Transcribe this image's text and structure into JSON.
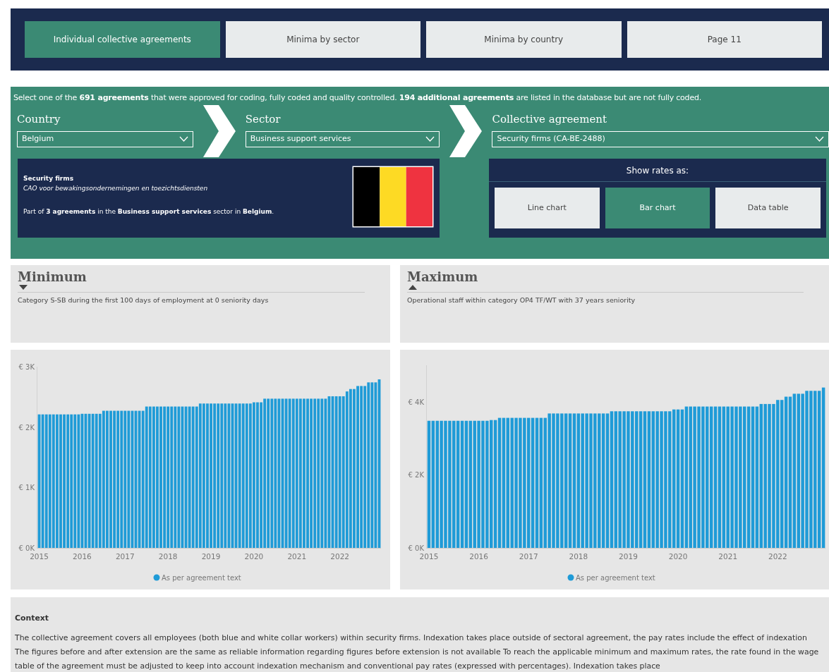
{
  "tabs": [
    {
      "label": "Individual collective agreements",
      "selected": true
    },
    {
      "label": "Minima by sector",
      "selected": false
    },
    {
      "label": "Minima by country",
      "selected": false
    },
    {
      "label": "Page 11",
      "selected": false
    }
  ],
  "filters": {
    "intro": "Select one of the **691 agreements** that were approved for coding, fully coded and quality controlled. **194 additional agreements** are listed in the database but are not fully coded.",
    "dropdowns": [
      {
        "label": "Country",
        "value": "Belgium"
      },
      {
        "label": "Sector",
        "value": "Business support services"
      },
      {
        "label": "Collective agreement",
        "value": "Security firms (CA-BE-2488)"
      }
    ]
  },
  "agreement_info": {
    "title": "Security firms",
    "subtitle": "CAO voor bewakingsondernemingen en toezichtsdiensten",
    "note": "Part of **3 agreements** in the **Business support services** sector in **Belgium**."
  },
  "rate_view": {
    "label": "Show rates as:",
    "options": [
      {
        "label": "Line chart",
        "selected": false
      },
      {
        "label": "Bar chart",
        "selected": true
      },
      {
        "label": "Data table",
        "selected": false
      }
    ]
  },
  "panels": [
    {
      "title": "Minimum",
      "kind": "minimum",
      "description": "Category S-SB during the first 100 days of employment at 0 seniority days",
      "chart_data": {
        "type": "bar",
        "x": [
          2015,
          2015.083,
          2015.167,
          2015.25,
          2015.333,
          2015.417,
          2015.5,
          2015.583,
          2015.667,
          2015.75,
          2015.833,
          2015.917,
          2016,
          2016.083,
          2016.167,
          2016.25,
          2016.333,
          2016.417,
          2016.5,
          2016.583,
          2016.667,
          2016.75,
          2016.833,
          2016.917,
          2017,
          2017.083,
          2017.167,
          2017.25,
          2017.333,
          2017.417,
          2017.5,
          2017.583,
          2017.667,
          2017.75,
          2017.833,
          2017.917,
          2018,
          2018.083,
          2018.167,
          2018.25,
          2018.333,
          2018.417,
          2018.5,
          2018.583,
          2018.667,
          2018.75,
          2018.833,
          2018.917,
          2019,
          2019.083,
          2019.167,
          2019.25,
          2019.333,
          2019.417,
          2019.5,
          2019.583,
          2019.667,
          2019.75,
          2019.833,
          2019.917,
          2020,
          2020.083,
          2020.167,
          2020.25,
          2020.333,
          2020.417,
          2020.5,
          2020.583,
          2020.667,
          2020.75,
          2020.833,
          2020.917,
          2021,
          2021.083,
          2021.167,
          2021.25,
          2021.333,
          2021.417,
          2021.5,
          2021.583,
          2021.667,
          2021.75,
          2021.833,
          2021.917,
          2022,
          2022.083,
          2022.167,
          2022.25,
          2022.333,
          2022.417,
          2022.5,
          2022.583,
          2022.667,
          2022.75,
          2022.833,
          2022.917
        ],
        "series": [
          {
            "name": "As per agreement text",
            "color": "#1f9bd7",
            "values": [
              2210,
              2210,
              2210,
              2210,
              2210,
              2210,
              2210,
              2210,
              2210,
              2210,
              2210,
              2210,
              2220,
              2220,
              2220,
              2220,
              2220,
              2220,
              2270,
              2270,
              2270,
              2270,
              2270,
              2270,
              2270,
              2270,
              2270,
              2270,
              2270,
              2270,
              2340,
              2340,
              2340,
              2340,
              2340,
              2340,
              2340,
              2340,
              2340,
              2340,
              2340,
              2340,
              2340,
              2340,
              2340,
              2390,
              2390,
              2390,
              2390,
              2390,
              2390,
              2390,
              2390,
              2390,
              2390,
              2390,
              2390,
              2390,
              2390,
              2390,
              2410,
              2410,
              2410,
              2470,
              2470,
              2470,
              2470,
              2470,
              2470,
              2470,
              2470,
              2470,
              2470,
              2470,
              2470,
              2470,
              2470,
              2470,
              2470,
              2470,
              2470,
              2510,
              2510,
              2510,
              2510,
              2510,
              2590,
              2630,
              2630,
              2680,
              2680,
              2680,
              2740,
              2740,
              2740,
              2790
            ]
          }
        ],
        "xlim": [
          2014.958,
          2022.958
        ],
        "ylim": [
          0,
          3000
        ],
        "yticks": [
          {
            "value": 0,
            "label": "€ 0K"
          },
          {
            "value": 1000,
            "label": "€ 1K"
          },
          {
            "value": 2000,
            "label": "€ 2K"
          },
          {
            "value": 3000,
            "label": "€ 3K"
          }
        ],
        "xticks": [
          2015,
          2016,
          2017,
          2018,
          2019,
          2020,
          2021,
          2022
        ]
      }
    },
    {
      "title": "Maximum",
      "kind": "maximum",
      "description": "Operational staff within category OP4 TF/WT with 37 years seniority",
      "chart_data": {
        "type": "bar",
        "x": [
          2015,
          2015.083,
          2015.167,
          2015.25,
          2015.333,
          2015.417,
          2015.5,
          2015.583,
          2015.667,
          2015.75,
          2015.833,
          2015.917,
          2016,
          2016.083,
          2016.167,
          2016.25,
          2016.333,
          2016.417,
          2016.5,
          2016.583,
          2016.667,
          2016.75,
          2016.833,
          2016.917,
          2017,
          2017.083,
          2017.167,
          2017.25,
          2017.333,
          2017.417,
          2017.5,
          2017.583,
          2017.667,
          2017.75,
          2017.833,
          2017.917,
          2018,
          2018.083,
          2018.167,
          2018.25,
          2018.333,
          2018.417,
          2018.5,
          2018.583,
          2018.667,
          2018.75,
          2018.833,
          2018.917,
          2019,
          2019.083,
          2019.167,
          2019.25,
          2019.333,
          2019.417,
          2019.5,
          2019.583,
          2019.667,
          2019.75,
          2019.833,
          2019.917,
          2020,
          2020.083,
          2020.167,
          2020.25,
          2020.333,
          2020.417,
          2020.5,
          2020.583,
          2020.667,
          2020.75,
          2020.833,
          2020.917,
          2021,
          2021.083,
          2021.167,
          2021.25,
          2021.333,
          2021.417,
          2021.5,
          2021.583,
          2021.667,
          2021.75,
          2021.833,
          2021.917,
          2022,
          2022.083,
          2022.167,
          2022.25,
          2022.333,
          2022.417,
          2022.5,
          2022.583,
          2022.667,
          2022.75,
          2022.833,
          2022.917
        ],
        "series": [
          {
            "name": "As per agreement text",
            "color": "#1f9bd7",
            "values": [
              3480,
              3480,
              3480,
              3480,
              3480,
              3480,
              3480,
              3480,
              3480,
              3480,
              3480,
              3480,
              3480,
              3480,
              3480,
              3500,
              3500,
              3560,
              3560,
              3560,
              3560,
              3560,
              3560,
              3560,
              3560,
              3560,
              3560,
              3560,
              3560,
              3680,
              3680,
              3680,
              3680,
              3680,
              3680,
              3680,
              3680,
              3680,
              3680,
              3680,
              3680,
              3680,
              3680,
              3680,
              3740,
              3740,
              3740,
              3740,
              3740,
              3740,
              3740,
              3740,
              3740,
              3740,
              3740,
              3740,
              3740,
              3740,
              3740,
              3790,
              3790,
              3790,
              3870,
              3870,
              3870,
              3870,
              3870,
              3870,
              3870,
              3870,
              3870,
              3870,
              3870,
              3870,
              3870,
              3870,
              3870,
              3870,
              3870,
              3870,
              3940,
              3940,
              3940,
              3940,
              4050,
              4050,
              4140,
              4140,
              4220,
              4220,
              4220,
              4300,
              4300,
              4300,
              4300,
              4390
            ]
          }
        ],
        "xlim": [
          2014.958,
          2022.958
        ],
        "ylim": [
          0,
          5000
        ],
        "yticks": [
          {
            "value": 0,
            "label": "€ 0K"
          },
          {
            "value": 2000,
            "label": "€ 2K"
          },
          {
            "value": 4000,
            "label": "€ 4K"
          }
        ],
        "xticks": [
          2015,
          2016,
          2017,
          2018,
          2019,
          2020,
          2021,
          2022
        ]
      }
    }
  ],
  "context": {
    "title": "Context",
    "text": "The collective agreement covers all employees (both blue and white collar workers) within security firms. Indexation takes place outside of sectoral agreement, the pay rates include the effect of indexation The figures before and after extension are the same as reliable information regarding figures before extension is not available To reach the applicable minimum and maximum rates, the rate found in the wage table of the agreement must be adjusted to keep into account indexation mechanism and conventional pay rates (expressed with percentages). Indexation takes place"
  }
}
